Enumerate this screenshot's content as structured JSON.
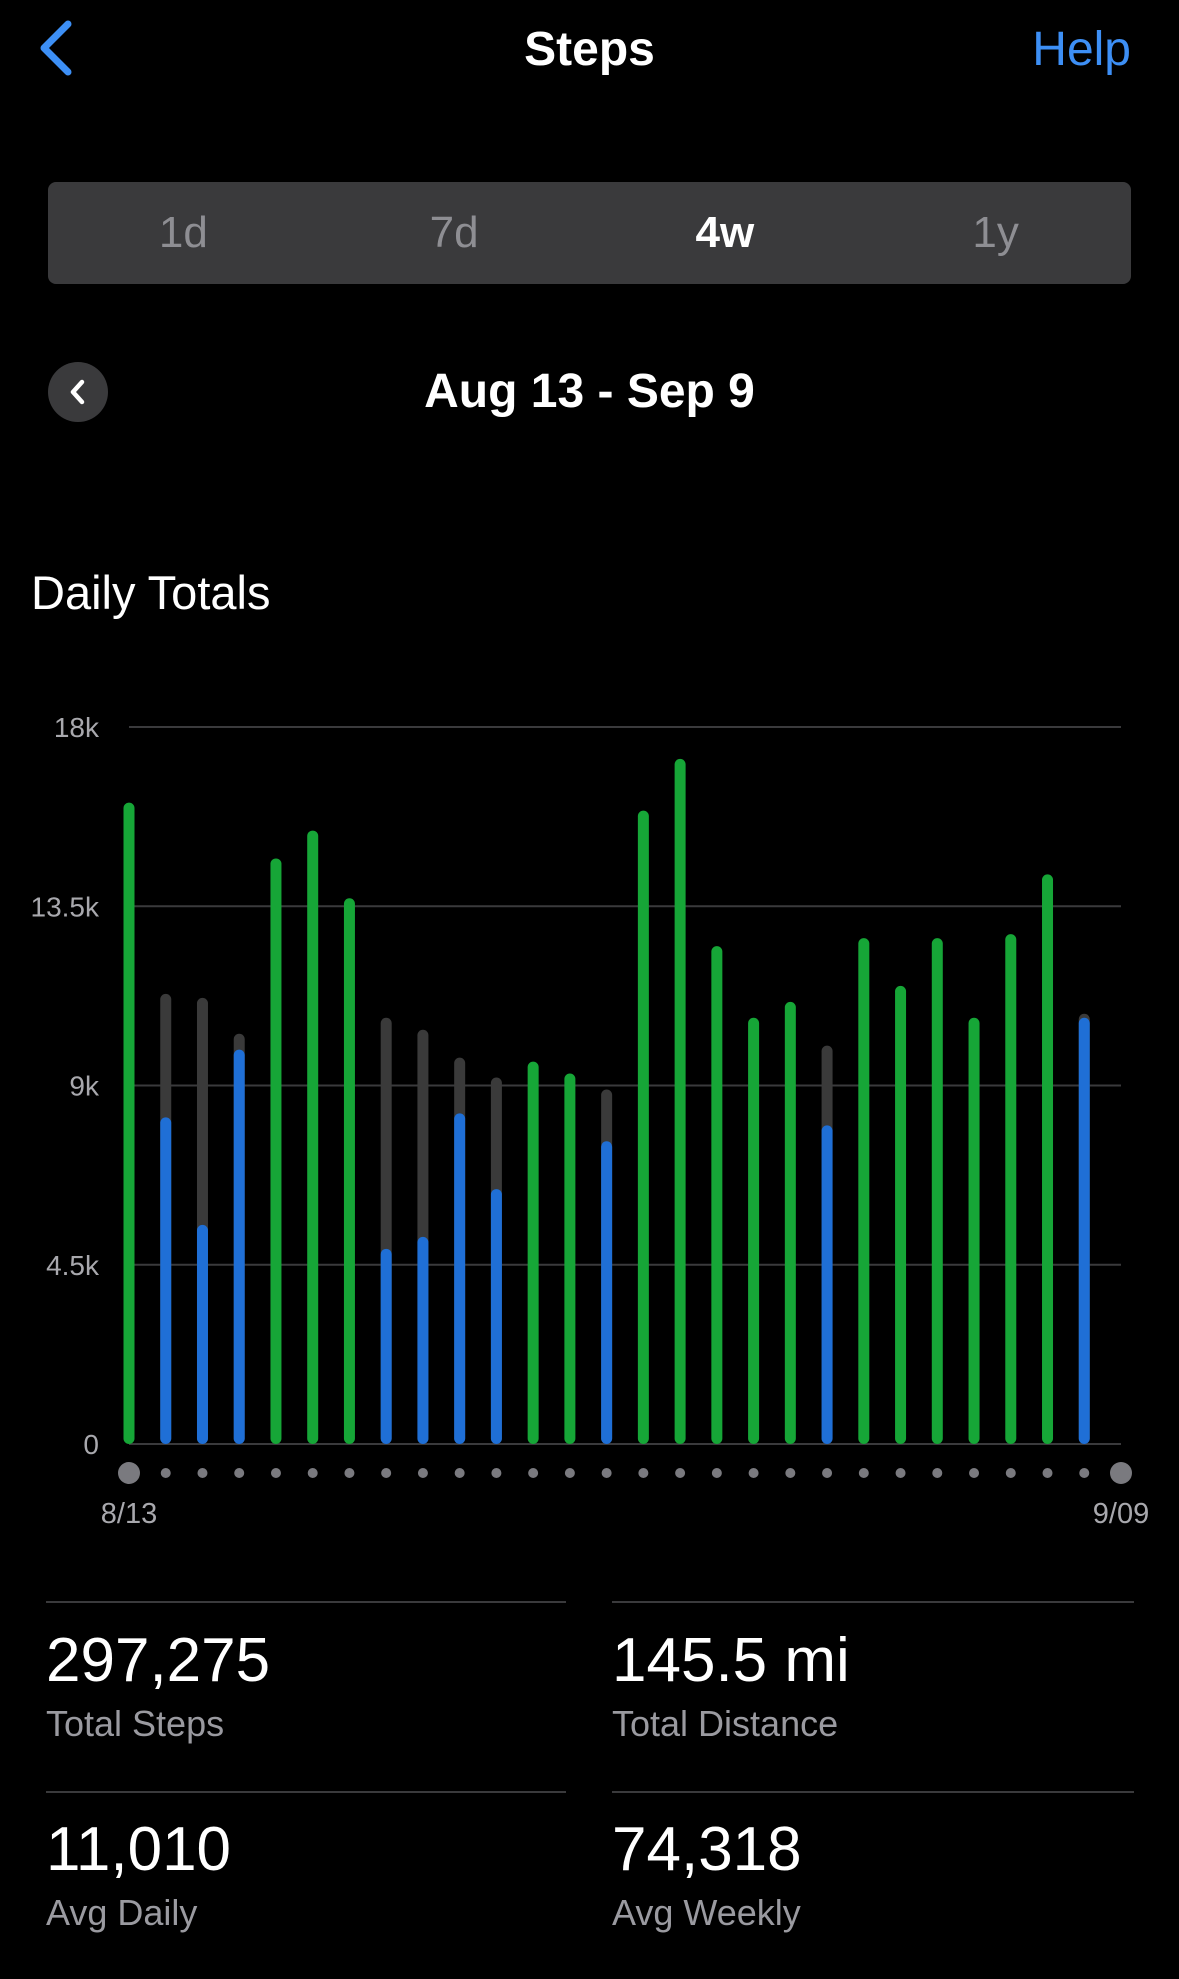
{
  "header": {
    "title": "Steps",
    "help_label": "Help",
    "back_icon": "chevron-left-icon"
  },
  "range_tabs": [
    {
      "label": "1d",
      "active": false
    },
    {
      "label": "7d",
      "active": false
    },
    {
      "label": "4w",
      "active": true
    },
    {
      "label": "1y",
      "active": false
    }
  ],
  "range": {
    "label": "Aug 13 - Sep 9",
    "prev_icon": "chevron-left-icon"
  },
  "section_title": "Daily Totals",
  "colors": {
    "goal_met": "#16a637",
    "steps": "#1f6fd6",
    "goal": "#3a3a3a",
    "accent": "#3d8ff5",
    "gridline": "#3a3a3c",
    "axis_text": "#a8a8ad",
    "dot": "#7a7a7f"
  },
  "chart_data": {
    "type": "bar",
    "x_start_label": "8/13",
    "x_end_label": "9/09",
    "ylim": [
      0,
      18000
    ],
    "y_ticks": [
      0,
      4500,
      9000,
      13500,
      18000
    ],
    "y_tick_labels": [
      "0",
      "4.5k",
      "9k",
      "13.5k",
      "18k"
    ],
    "grid": true,
    "series": [
      {
        "values": [
          16100,
          8200,
          5500,
          9900,
          14700,
          15400,
          13700,
          4900,
          5200,
          8300,
          6400,
          9600,
          9300,
          7600,
          15900,
          17200,
          12500,
          10700,
          11100,
          8000,
          12700,
          11500,
          12700,
          10700,
          12800,
          14300,
          10700
        ]
      },
      {
        "values": [
          0,
          11300,
          11200,
          10300,
          0,
          0,
          0,
          10700,
          10400,
          9700,
          9200,
          0,
          0,
          8900,
          0,
          0,
          0,
          0,
          0,
          10000,
          0,
          0,
          0,
          0,
          0,
          0,
          10800
        ]
      }
    ]
  },
  "stats": [
    {
      "value": "297,275",
      "label": "Total Steps"
    },
    {
      "value": "145.5 mi",
      "label": "Total Distance"
    },
    {
      "value": "11,010",
      "label": "Avg Daily"
    },
    {
      "value": "74,318",
      "label": "Avg Weekly"
    }
  ]
}
